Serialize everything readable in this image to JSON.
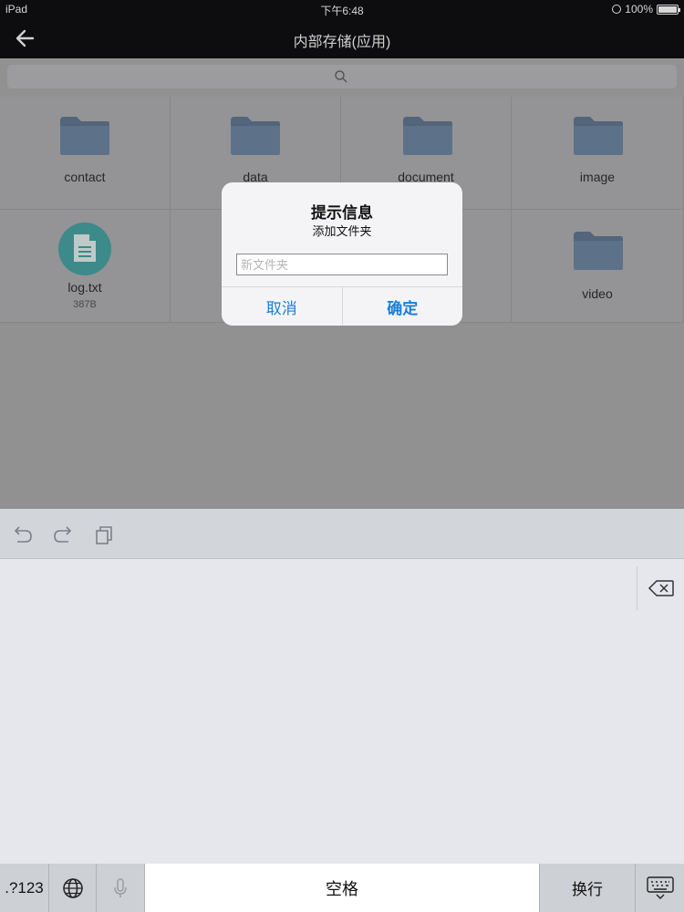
{
  "status_bar": {
    "device": "iPad",
    "time": "下午6:48",
    "battery": "100%"
  },
  "nav": {
    "title": "内部存储(应用)"
  },
  "files": [
    {
      "name": "contact",
      "type": "folder"
    },
    {
      "name": "data",
      "type": "folder"
    },
    {
      "name": "document",
      "type": "folder"
    },
    {
      "name": "image",
      "type": "folder"
    },
    {
      "name": "log.txt",
      "type": "file",
      "size": "387B"
    },
    {
      "name": "video",
      "type": "folder"
    }
  ],
  "dialog": {
    "title": "提示信息",
    "message": "添加文件夹",
    "input_value": "",
    "input_placeholder": "新文件夹",
    "cancel_label": "取消",
    "confirm_label": "确定"
  },
  "keyboard": {
    "numbers_label": ".?123",
    "space_label": "空格",
    "return_label": "换行"
  },
  "colors": {
    "accent": "#1a7ed6",
    "folder": "#5b6f86",
    "file_icon": "#3c8a89"
  }
}
